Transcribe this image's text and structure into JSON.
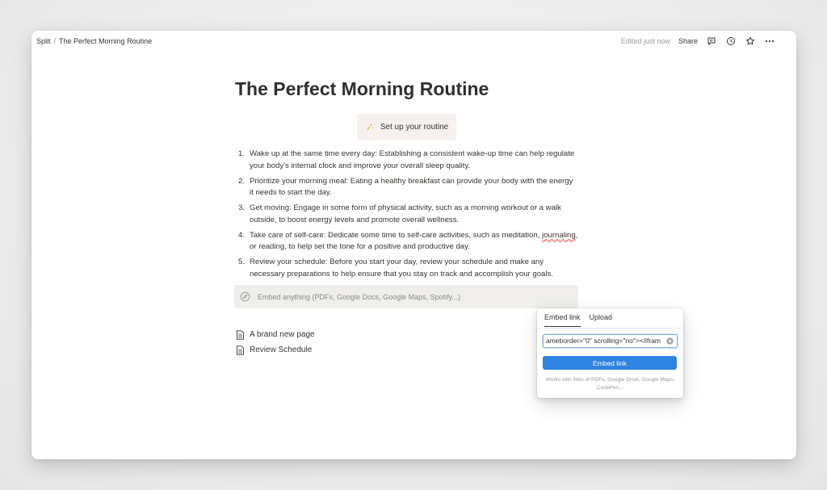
{
  "breadcrumb": {
    "parent": "Split",
    "separator": "/",
    "current": "The Perfect Morning Routine"
  },
  "topbar": {
    "edited": "Edited just now",
    "share": "Share"
  },
  "page": {
    "title": "The Perfect Morning Routine",
    "setup_button": "Set up your routine",
    "list": [
      {
        "num": "1.",
        "text": "Wake up at the same time every day: Establishing a consistent wake-up time can help regulate your body's internal clock and improve your overall sleep quality."
      },
      {
        "num": "2.",
        "text": "Prioritize your morning meal: Eating a healthy breakfast can provide your body with the energy it needs to start the day."
      },
      {
        "num": "3.",
        "text": "Get moving: Engage in some form of physical activity, such as a morning workout or a walk outside, to boost energy levels and promote overall wellness."
      },
      {
        "num": "4.",
        "text_before": "Take care of self-care: Dedicate some time to self-care activities, such as meditation, ",
        "text_squiggle": "journaling",
        "text_after": ", or reading, to help set the tone for a positive and productive day."
      },
      {
        "num": "5.",
        "text": "Review your schedule: Before you start your day, review your schedule and make any necessary preparations to help ensure that you stay on track and accomplish your goals."
      }
    ],
    "embed_placeholder": "Embed anything (PDFs, Google Docs, Google Maps, Spotify...)",
    "pages": [
      "A brand new page",
      "Review Schedule"
    ]
  },
  "popover": {
    "tabs": [
      "Embed link",
      "Upload"
    ],
    "input_value": "ameborder=\"0\" scrolling=\"no\"></ifram",
    "button": "Embed link",
    "hint": "Works with links of PDFs, Google Drive, Google Maps, CodePen..."
  },
  "colors": {
    "accent": "#2f83e3",
    "embed_bg": "#efeeea",
    "setup_bg": "#f6f1ef"
  }
}
